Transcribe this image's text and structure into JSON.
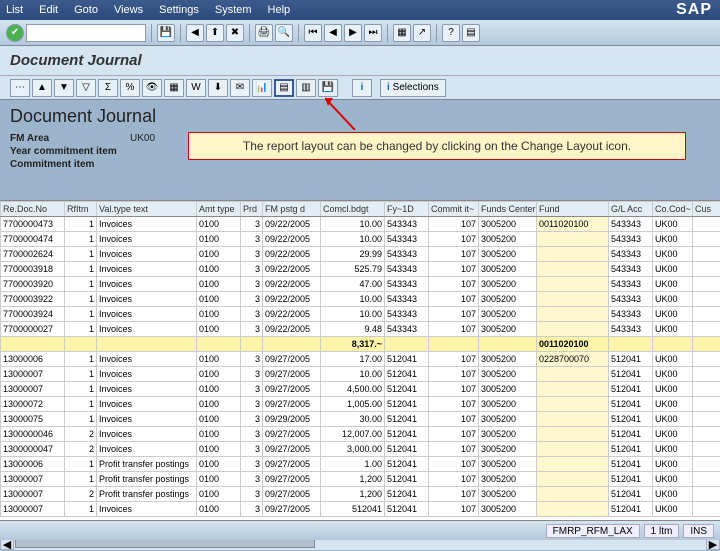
{
  "menubar": {
    "items": [
      "List",
      "Edit",
      "Goto",
      "Views",
      "Settings",
      "System",
      "Help"
    ],
    "logo": "SAP"
  },
  "header": {
    "title": "Document Journal"
  },
  "toolbar2": {
    "selections_label": "Selections"
  },
  "doc": {
    "title": "Document Journal",
    "meta": [
      {
        "label": "FM Area",
        "value": "UK00"
      },
      {
        "label": "Year commitment item",
        "value": ""
      },
      {
        "label": "Commitment item",
        "value": ""
      }
    ]
  },
  "callout": "The report layout can be changed by clicking on the Change Layout icon.",
  "table": {
    "headers": [
      "Re.Doc.No",
      "RfItm",
      "Val.type text",
      "Amt type",
      "Prd",
      "FM pstg d",
      "Comcl.bdgt",
      "Fy~1D",
      "Commit it~",
      "Funds Center",
      "Fund",
      "G/L Acc",
      "Co.Cod~",
      "Cus"
    ],
    "rows": [
      {
        "cells": [
          "7700000473",
          "1",
          "Invoices",
          "0100",
          "3",
          "09/22/2005",
          "10.00",
          "543343",
          "107",
          "3005200",
          "0011020100",
          "543343",
          "UK00",
          ""
        ]
      },
      {
        "cells": [
          "7700000474",
          "1",
          "Invoices",
          "0100",
          "3",
          "09/22/2005",
          "10.00",
          "543343",
          "107",
          "3005200",
          "",
          "543343",
          "UK00",
          ""
        ]
      },
      {
        "cells": [
          "7700002624",
          "1",
          "Invoices",
          "0100",
          "3",
          "09/22/2005",
          "29.99",
          "543343",
          "107",
          "3005200",
          "",
          "543343",
          "UK00",
          ""
        ]
      },
      {
        "cells": [
          "7700003918",
          "1",
          "Invoices",
          "0100",
          "3",
          "09/22/2005",
          "525.79",
          "543343",
          "107",
          "3005200",
          "",
          "543343",
          "UK00",
          ""
        ]
      },
      {
        "cells": [
          "7700003920",
          "1",
          "Invoices",
          "0100",
          "3",
          "09/22/2005",
          "47.00",
          "543343",
          "107",
          "3005200",
          "",
          "543343",
          "UK00",
          ""
        ]
      },
      {
        "cells": [
          "7700003922",
          "1",
          "Invoices",
          "0100",
          "3",
          "09/22/2005",
          "10.00",
          "543343",
          "107",
          "3005200",
          "",
          "543343",
          "UK00",
          ""
        ]
      },
      {
        "cells": [
          "7700003924",
          "1",
          "Invoices",
          "0100",
          "3",
          "09/22/2005",
          "10.00",
          "543343",
          "107",
          "3005200",
          "",
          "543343",
          "UK00",
          ""
        ]
      },
      {
        "cells": [
          "7700000027",
          "1",
          "Invoices",
          "0100",
          "3",
          "09/22/2005",
          "9.48",
          "543343",
          "107",
          "3005200",
          "",
          "543343",
          "UK00",
          ""
        ]
      },
      {
        "subtotal": true,
        "cells": [
          "",
          "",
          "",
          "",
          "",
          "",
          "8,317.~",
          "",
          "",
          "",
          "0011020100",
          "",
          "",
          ""
        ]
      },
      {
        "cells": [
          "13000006",
          "1",
          "Invoices",
          "0100",
          "3",
          "09/27/2005",
          "17.00",
          "512041",
          "107",
          "3005200",
          "0228700070",
          "512041",
          "UK00",
          ""
        ]
      },
      {
        "cells": [
          "13000007",
          "1",
          "Invoices",
          "0100",
          "3",
          "09/27/2005",
          "10.00",
          "512041",
          "107",
          "3005200",
          "",
          "512041",
          "UK00",
          ""
        ]
      },
      {
        "cells": [
          "13000007",
          "1",
          "Invoices",
          "0100",
          "3",
          "09/27/2005",
          "4,500.00",
          "512041",
          "107",
          "3005200",
          "",
          "512041",
          "UK00",
          ""
        ]
      },
      {
        "cells": [
          "13000072",
          "1",
          "Invoices",
          "0100",
          "3",
          "09/27/2005",
          "1,005.00",
          "512041",
          "107",
          "3005200",
          "",
          "512041",
          "UK00",
          ""
        ]
      },
      {
        "cells": [
          "13000075",
          "1",
          "Invoices",
          "0100",
          "3",
          "09/29/2005",
          "30.00",
          "512041",
          "107",
          "3005200",
          "",
          "512041",
          "UK00",
          ""
        ]
      },
      {
        "cells": [
          "1300000046",
          "2",
          "Invoices",
          "0100",
          "3",
          "09/27/2005",
          "12,007.00",
          "512041",
          "107",
          "3005200",
          "",
          "512041",
          "UK00",
          ""
        ]
      },
      {
        "cells": [
          "1300000047",
          "2",
          "Invoices",
          "0100",
          "3",
          "09/27/2005",
          "3,000.00",
          "512041",
          "107",
          "3005200",
          "",
          "512041",
          "UK00",
          ""
        ]
      },
      {
        "cells": [
          "13000006",
          "1",
          "Profit transfer postings",
          "0100",
          "3",
          "09/27/2005",
          "1.00",
          "512041",
          "107",
          "3005200",
          "",
          "512041",
          "UK00",
          ""
        ]
      },
      {
        "cells": [
          "13000007",
          "1",
          "Profit transfer postings",
          "0100",
          "3",
          "09/27/2005",
          "1,200",
          "512041",
          "107",
          "3005200",
          "",
          "512041",
          "UK00",
          ""
        ]
      },
      {
        "cells": [
          "13000007",
          "2",
          "Profit transfer postings",
          "0100",
          "3",
          "09/27/2005",
          "1,200",
          "512041",
          "107",
          "3005200",
          "",
          "512041",
          "UK00",
          ""
        ]
      },
      {
        "cells": [
          "13000007",
          "1",
          "Invoices",
          "0100",
          "3",
          "09/27/2005",
          "512041",
          "512041",
          "107",
          "3005200",
          "",
          "512041",
          "UK00",
          ""
        ]
      }
    ]
  },
  "statusbar": {
    "server": "FMRP_RFM_LAX",
    "client": "1 ltm",
    "sys": "INS"
  }
}
